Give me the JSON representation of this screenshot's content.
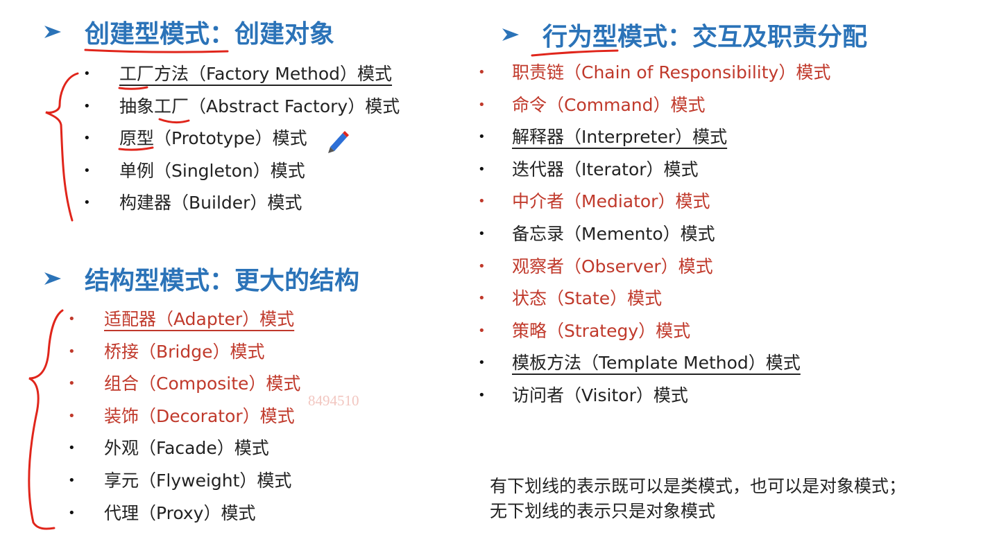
{
  "creational": {
    "title": "创建型模式：创建对象",
    "items": [
      {
        "label": "工厂方法（Factory Method）模式",
        "underlined": true,
        "red": false
      },
      {
        "label": "抽象工厂（Abstract Factory）模式",
        "underlined": false,
        "red": false
      },
      {
        "label": "原型（Prototype）模式",
        "underlined": false,
        "red": false
      },
      {
        "label": "单例（Singleton）模式",
        "underlined": false,
        "red": false
      },
      {
        "label": "构建器（Builder）模式",
        "underlined": false,
        "red": false
      }
    ]
  },
  "structural": {
    "title": "结构型模式：更大的结构",
    "items": [
      {
        "label": "适配器（Adapter）模式",
        "underlined": true,
        "red": true
      },
      {
        "label": "桥接（Bridge）模式",
        "underlined": false,
        "red": true
      },
      {
        "label": "组合（Composite）模式",
        "underlined": false,
        "red": true
      },
      {
        "label": "装饰（Decorator）模式",
        "underlined": false,
        "red": true
      },
      {
        "label": "外观（Facade）模式",
        "underlined": false,
        "red": false
      },
      {
        "label": "享元（Flyweight）模式",
        "underlined": false,
        "red": false
      },
      {
        "label": "代理（Proxy）模式",
        "underlined": false,
        "red": false
      }
    ]
  },
  "behavioral": {
    "title": "行为型模式：交互及职责分配",
    "items": [
      {
        "label": "职责链（Chain of Responsibility）模式",
        "underlined": false,
        "red": true
      },
      {
        "label": "命令（Command）模式",
        "underlined": false,
        "red": true
      },
      {
        "label": "解释器（Interpreter）模式",
        "underlined": true,
        "red": false
      },
      {
        "label": "迭代器（Iterator）模式",
        "underlined": false,
        "red": false
      },
      {
        "label": "中介者（Mediator）模式",
        "underlined": false,
        "red": true
      },
      {
        "label": "备忘录（Memento）模式",
        "underlined": false,
        "red": false
      },
      {
        "label": "观察者（Observer）模式",
        "underlined": false,
        "red": true
      },
      {
        "label": "状态（State）模式",
        "underlined": false,
        "red": true
      },
      {
        "label": "策略（Strategy）模式",
        "underlined": false,
        "red": true
      },
      {
        "label": "模板方法（Template Method）模式",
        "underlined": true,
        "red": false
      },
      {
        "label": "访问者（Visitor）模式",
        "underlined": false,
        "red": false
      }
    ]
  },
  "note": {
    "line1": "有下划线的表示既可以是类模式，也可以是对象模式；",
    "line2": "无下划线的表示只是对象模式"
  },
  "watermark": "8494510",
  "colors": {
    "heading": "#2b73b8",
    "text": "#222222",
    "highlight_red": "#c0392b",
    "annotation_red": "#e0251b"
  }
}
